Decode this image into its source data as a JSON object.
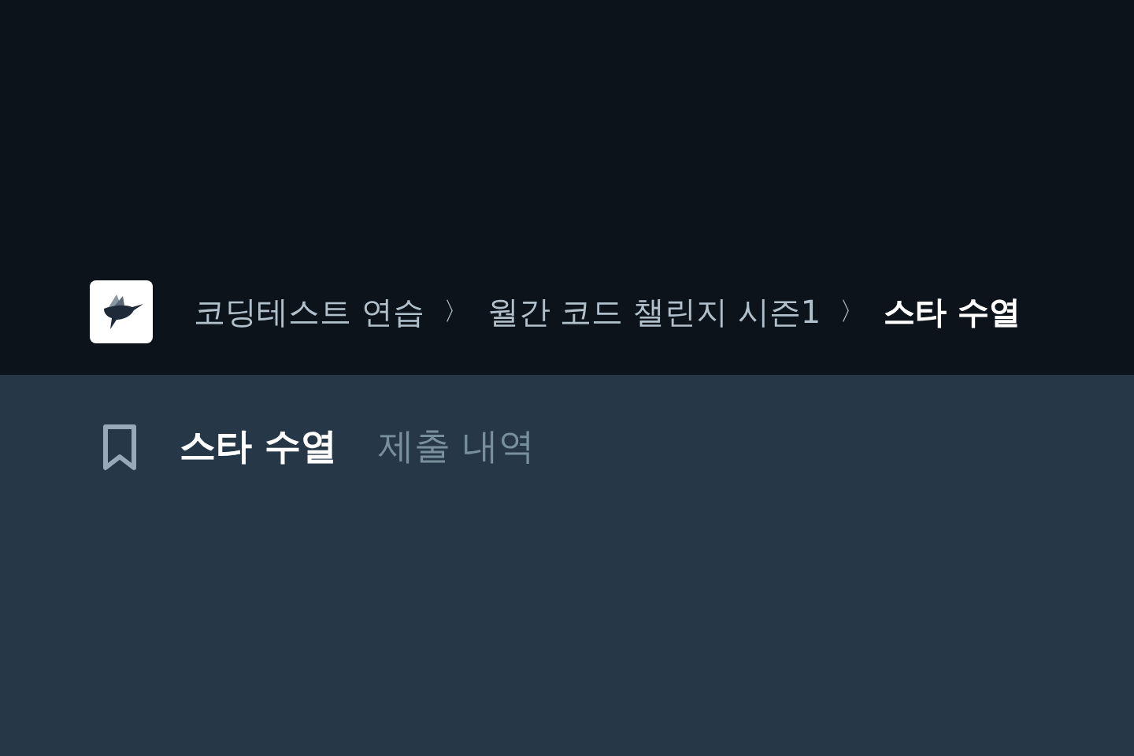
{
  "breadcrumb": [
    {
      "label": "코딩테스트 연습",
      "selected": false
    },
    {
      "label": "월간 코드 챌린지 시즌1",
      "selected": false
    },
    {
      "label": "스타 수열",
      "selected": true
    }
  ],
  "breadcrumb_separator": "〉",
  "tabs": [
    {
      "label": "스타 수열",
      "selected": true
    },
    {
      "label": "제출 내역",
      "selected": false
    }
  ]
}
